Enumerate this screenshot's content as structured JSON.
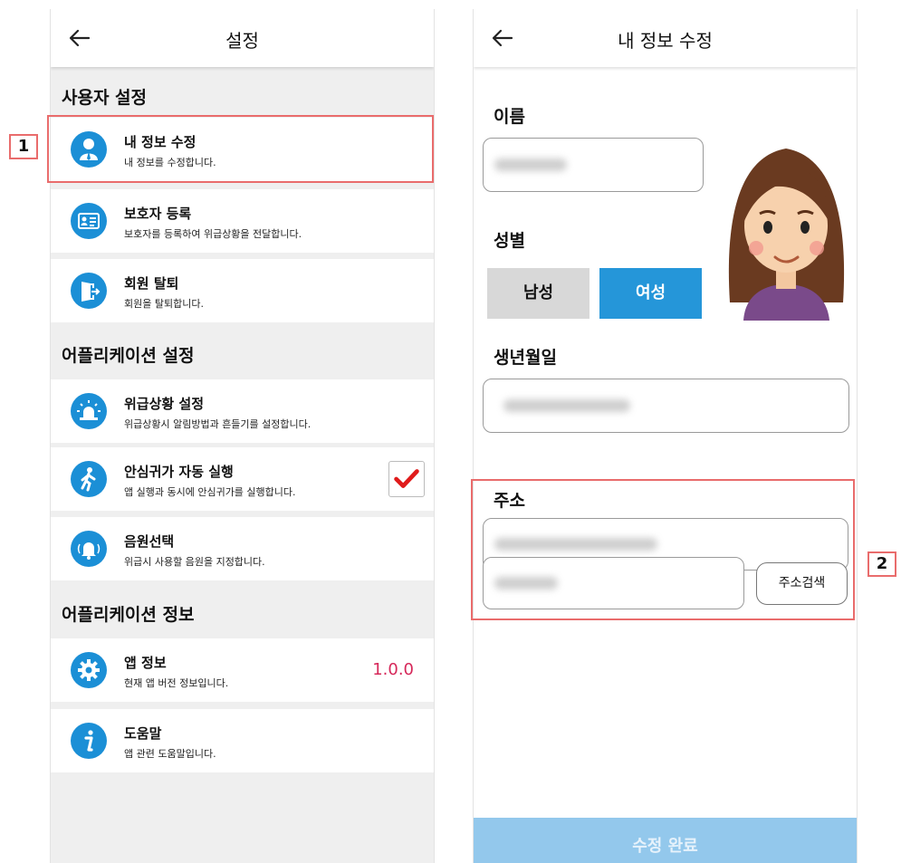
{
  "settings_screen": {
    "title": "설정",
    "sections": [
      {
        "title": "사용자 설정",
        "items": [
          {
            "label": "내 정보 수정",
            "desc": "내 정보를 수정합니다.",
            "icon": "user-icon"
          },
          {
            "label": "보호자 등록",
            "desc": "보호자를 등록하여 위급상황을 전달합니다.",
            "icon": "id-card-icon"
          },
          {
            "label": "회원 탈퇴",
            "desc": "회원을 탈퇴합니다.",
            "icon": "exit-door-icon"
          }
        ]
      },
      {
        "title": "어플리케이션 설정",
        "items": [
          {
            "label": "위급상황 설정",
            "desc": "위급상황시 알림방법과 흔들기를 설정합니다.",
            "icon": "siren-icon"
          },
          {
            "label": "안심귀가 자동 실행",
            "desc": "앱 실행과 동시에 안심귀가를 실행합니다.",
            "icon": "walking-person-icon",
            "checked": true
          },
          {
            "label": "음원선택",
            "desc": "위급시 사용할 음원을 지정합니다.",
            "icon": "bell-icon"
          }
        ]
      },
      {
        "title": "어플리케이션 정보",
        "items": [
          {
            "label": "앱 정보",
            "desc": "현재 앱 버전 정보입니다.",
            "icon": "gear-icon",
            "value": "1.0.0"
          },
          {
            "label": "도움말",
            "desc": "앱 관련 도움말입니다.",
            "icon": "info-icon"
          }
        ]
      }
    ]
  },
  "edit_screen": {
    "title": "내 정보 수정",
    "name_label": "이름",
    "gender_label": "성별",
    "gender_options": [
      "남성",
      "여성"
    ],
    "gender_selected": "여성",
    "birth_label": "생년월일",
    "address_label": "주소",
    "address_search_button": "주소검색",
    "submit_button": "수정 완료"
  },
  "annotations": [
    "1",
    "2"
  ],
  "colors": {
    "accent_blue": "#1b8fd6",
    "selected_blue": "#2596d9",
    "version_red": "#d6285a",
    "highlight_red": "#e96c6c",
    "submit_disabled": "#93c8ec"
  }
}
